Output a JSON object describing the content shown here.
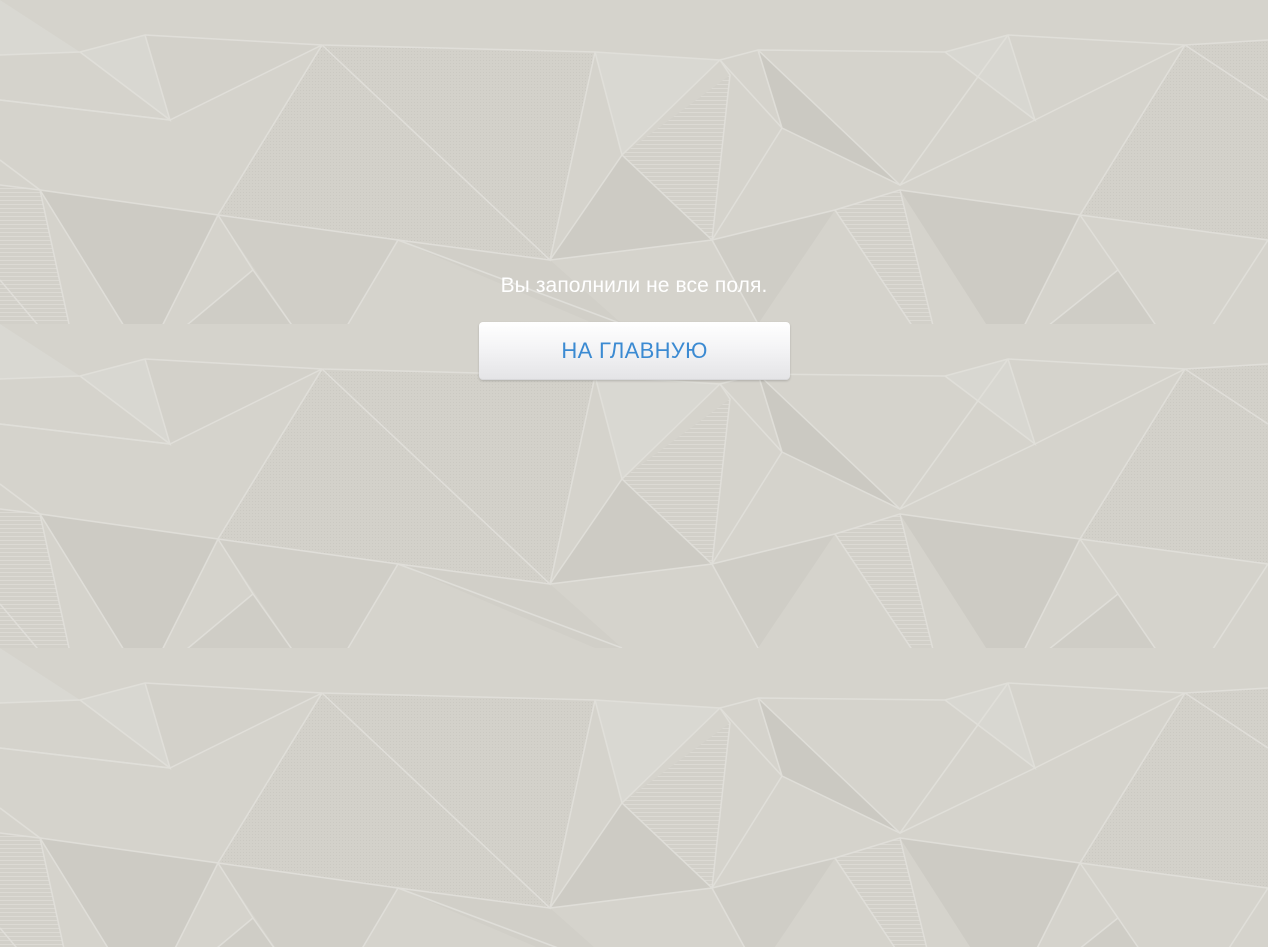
{
  "message": {
    "text": "Вы заполнили не все поля."
  },
  "button": {
    "label": "НА ГЛАВНУЮ"
  },
  "colors": {
    "background": "#d4d2cb",
    "message_text": "#ffffff",
    "button_text": "#3b8ad2"
  }
}
